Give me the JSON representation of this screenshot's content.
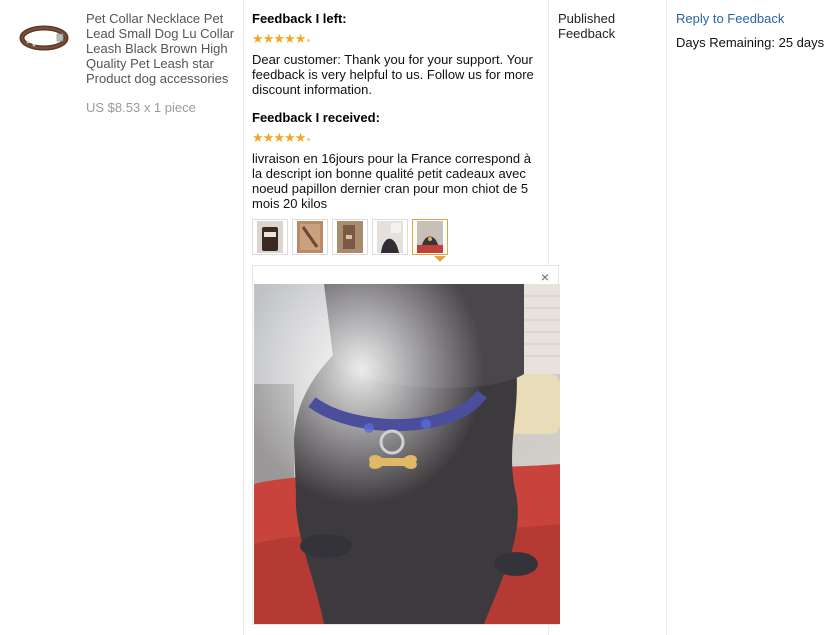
{
  "product": {
    "title": "Pet Collar Necklace Pet Lead Small Dog Lu Collar Leash Black Brown High Quality Pet Leash star Product dog accessories",
    "price": "US $8.53 x 1 piece",
    "thumb_icon": "collar-thumbnail"
  },
  "feedback_left": {
    "heading": "Feedback I left:",
    "rating": 5,
    "text": "Dear customer: Thank you for your support. Your feedback is very helpful to us. Follow us for more discount information."
  },
  "feedback_received": {
    "heading": "Feedback I received:",
    "rating": 5,
    "text": "livraison en 16jours pour la France correspond à la descript ion bonne qualité petit cadeaux avec noeud papillon dernier cran pour mon chiot de 5 mois 20 kilos",
    "photos": [
      {
        "name": "photo-1"
      },
      {
        "name": "photo-2"
      },
      {
        "name": "photo-3"
      },
      {
        "name": "photo-4"
      },
      {
        "name": "photo-5",
        "active": true
      }
    ],
    "viewer_close_icon": "×"
  },
  "status": {
    "label": "Published Feedback"
  },
  "actions": {
    "reply_label": "Reply to Feedback",
    "days_remaining": "Days Remaining: 25 days"
  },
  "colors": {
    "star": "#f5a623",
    "link": "#2a64a8",
    "active_thumb": "#e6a23c"
  }
}
